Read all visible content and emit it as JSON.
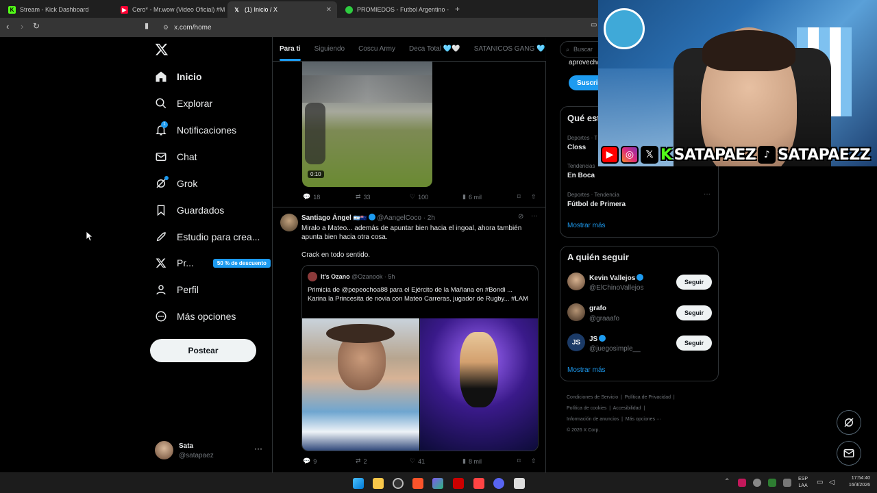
{
  "browser": {
    "tabs": [
      {
        "title": "Stream - Kick Dashboard",
        "favicon_color": "#53fc18"
      },
      {
        "title": "Cero* - Mr.wow (Video Oficial) #Mer",
        "favicon_color": "#ff0033"
      },
      {
        "title": "(1) Inicio / X",
        "favicon_color": "#ffffff"
      },
      {
        "title": "PROMIEDOS - Futbol Argentino - Fix",
        "favicon_color": "#2ecc40"
      }
    ],
    "url": "x.com/home"
  },
  "sidebar": {
    "items": [
      {
        "label": "Inicio",
        "icon": "home-icon"
      },
      {
        "label": "Explorar",
        "icon": "search-icon"
      },
      {
        "label": "Notificaciones",
        "icon": "bell-icon",
        "badge": "1"
      },
      {
        "label": "Chat",
        "icon": "mail-icon"
      },
      {
        "label": "Grok",
        "icon": "grok-icon"
      },
      {
        "label": "Guardados",
        "icon": "bookmark-icon"
      },
      {
        "label": "Estudio para crea...",
        "icon": "rocket-icon"
      },
      {
        "label": "Pr...",
        "icon": "x-logo-icon",
        "badge": "50 % de descuento"
      },
      {
        "label": "Perfil",
        "icon": "person-icon"
      },
      {
        "label": "Más opciones",
        "icon": "more-circle-icon"
      }
    ],
    "post_label": "Postear",
    "account": {
      "name": "Sata",
      "handle": "@satapaez"
    }
  },
  "timeline": {
    "tabs": [
      "Para ti",
      "Siguiendo",
      "Coscu Army",
      "Deca Total 🩵🤍",
      "SATANICOS GANG 🩵"
    ],
    "video_duration": "0:10",
    "post1_stats": {
      "replies": "18",
      "reposts": "33",
      "likes": "100",
      "views": "6 mil"
    },
    "post2": {
      "author": "Santiago Ángel",
      "handle": "@AangelCoco",
      "time": "· 2h",
      "text1": "Miralo a Mateo... además de apuntar bien hacia el ingoal, ahora también apunta bien hacia otra cosa.",
      "text2": "Crack en todo sentido.",
      "quote": {
        "author": "It's Ozano",
        "handle": "@Ozanook",
        "time": "· 5h",
        "text": "Primicia de @pepeochoa88 para el Ejército de la Mañana en #Bondi ... Karina la Princesita de novia con Mateo Carreras, jugador de Rugby... #LAM"
      },
      "stats": {
        "replies": "9",
        "reposts": "2",
        "likes": "41",
        "views": "8 mil"
      }
    }
  },
  "right": {
    "search_placeholder": "Buscar",
    "premium_text": "aprovecha",
    "subscribe_label": "Suscrib",
    "trends_title": "Qué est",
    "trends": [
      {
        "category": "Deportes · T",
        "name": "Closs"
      },
      {
        "category": "Tendencias",
        "name": "En Boca"
      },
      {
        "category": "Deportes · Tendencia",
        "name": "Fútbol de Primera"
      }
    ],
    "show_more": "Mostrar más",
    "follow_title": "A quién seguir",
    "follow": [
      {
        "name": "Kevin Vallejos",
        "handle": "@ElChinoVallejos",
        "verified": true
      },
      {
        "name": "grafo",
        "handle": "@graaafo",
        "verified": false
      },
      {
        "name": "JS",
        "handle": "@juegosimple__",
        "verified": true
      }
    ],
    "follow_label": "Seguir",
    "footer": [
      "Condiciones de Servicio",
      "Política de Privacidad",
      "Política de cookies",
      "Accesibilidad",
      "Información de anuncios",
      "Más opciones ···",
      "© 2026 X Corp."
    ]
  },
  "overlay": {
    "names": [
      "SATAPAEZ",
      "SATAPAEZZ"
    ]
  },
  "system": {
    "lang1": "ESP",
    "lang2": "LAA",
    "time": "17:54:40",
    "date": "16/3/2026"
  }
}
